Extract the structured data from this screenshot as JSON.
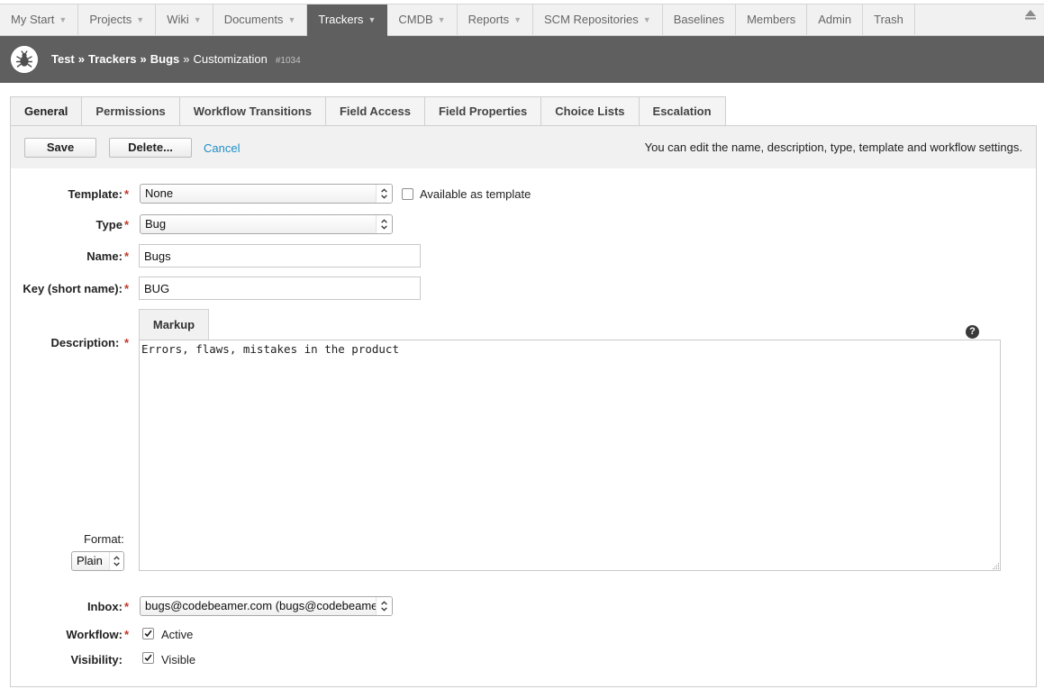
{
  "nav": {
    "items": [
      {
        "label": "My Start",
        "caret": true
      },
      {
        "label": "Projects",
        "caret": true
      },
      {
        "label": "Wiki",
        "caret": true
      },
      {
        "label": "Documents",
        "caret": true
      },
      {
        "label": "Trackers",
        "caret": true,
        "active": true
      },
      {
        "label": "CMDB",
        "caret": true
      },
      {
        "label": "Reports",
        "caret": true
      },
      {
        "label": "SCM Repositories",
        "caret": true
      },
      {
        "label": "Baselines",
        "caret": false
      },
      {
        "label": "Members",
        "caret": false
      },
      {
        "label": "Admin",
        "caret": false
      },
      {
        "label": "Trash",
        "caret": false
      }
    ],
    "caret_glyph": "▼",
    "collapse_icon": "eject-icon"
  },
  "header": {
    "icon": "bug-icon",
    "crumbs": [
      "Test",
      "Trackers",
      "Bugs"
    ],
    "separator": "»",
    "current": "Customization",
    "item_id": "#1034"
  },
  "tabs": [
    {
      "label": "General",
      "active": true
    },
    {
      "label": "Permissions"
    },
    {
      "label": "Workflow Transitions"
    },
    {
      "label": "Field Access"
    },
    {
      "label": "Field Properties"
    },
    {
      "label": "Choice Lists"
    },
    {
      "label": "Escalation"
    }
  ],
  "actions": {
    "save_label": "Save",
    "delete_label": "Delete...",
    "cancel_label": "Cancel",
    "hint": "You can edit the name, description, type, template and workflow settings."
  },
  "form": {
    "required_marker": "*",
    "template": {
      "label": "Template:",
      "value": "None",
      "available_label": "Available as template",
      "available_checked": false
    },
    "type": {
      "label": "Type",
      "value": "Bug"
    },
    "name": {
      "label": "Name:",
      "value": "Bugs"
    },
    "key": {
      "label": "Key (short name):",
      "value": "BUG"
    },
    "description": {
      "label": "Description: ",
      "markup_tab": "Markup",
      "value": "Errors, flaws, mistakes in the product",
      "help_glyph": "?"
    },
    "format": {
      "label": "Format:",
      "value": "Plain"
    },
    "inbox": {
      "label": "Inbox:",
      "value": "bugs@codebeamer.com (bugs@codebeamer.com)"
    },
    "workflow": {
      "label": "Workflow:",
      "checkbox_label": "Active",
      "checked": true
    },
    "visibility": {
      "label": "Visibility:",
      "checkbox_label": "Visible",
      "checked": true
    }
  },
  "colors": {
    "header_bg": "#5f5f5f",
    "link": "#1f8dc6",
    "required": "#c0392b"
  }
}
